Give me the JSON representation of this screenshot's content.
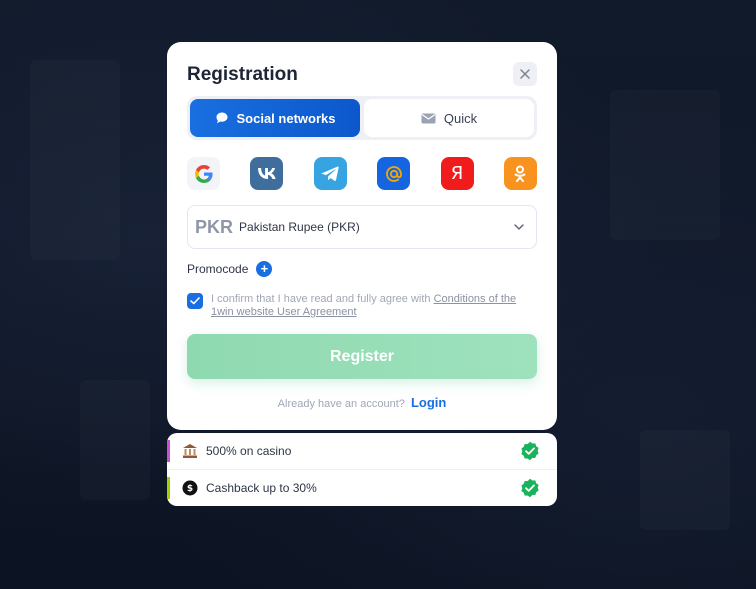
{
  "modal": {
    "title": "Registration",
    "close_icon": "close-icon"
  },
  "tabs": [
    {
      "label": "Social networks",
      "icon": "chat-bubble-icon",
      "active": true
    },
    {
      "label": "Quick",
      "icon": "envelope-icon",
      "active": false
    }
  ],
  "social_networks": [
    {
      "name": "Google",
      "icon": "google-icon",
      "color": "#f3f4f7"
    },
    {
      "name": "VK",
      "icon": "vk-icon",
      "color": "#3f6d9c"
    },
    {
      "name": "Telegram",
      "icon": "telegram-icon",
      "color": "#36a4e0"
    },
    {
      "name": "Mail.ru",
      "icon": "mail-at-icon",
      "color": "#1565e0"
    },
    {
      "name": "Yandex",
      "icon": "yandex-icon",
      "color": "#f01c1c"
    },
    {
      "name": "Odnoklassniki",
      "icon": "odnoklassniki-icon",
      "color": "#f7931e"
    }
  ],
  "currency": {
    "code": "PKR",
    "name": "Pakistan Rupee (PKR)"
  },
  "promocode": {
    "label": "Promocode",
    "add_symbol": "+"
  },
  "agreement": {
    "checked": true,
    "text": "I confirm that I have read and fully agree with",
    "link": "Conditions of the 1win website User Agreement"
  },
  "register": {
    "label": "Register"
  },
  "login": {
    "prompt": "Already have an account?",
    "link": "Login"
  },
  "bonuses": [
    {
      "text": "500% on casino",
      "icon": "bank-icon",
      "bar_color": "#c84fd8",
      "checked": true
    },
    {
      "text": "Cashback up to 30%",
      "icon": "cashback-icon",
      "bar_color": "#9fd400",
      "checked": true
    }
  ],
  "colors": {
    "accent": "#1a6fe0",
    "register_green": "#9ee2bd",
    "check_green": "#1ab35c"
  }
}
